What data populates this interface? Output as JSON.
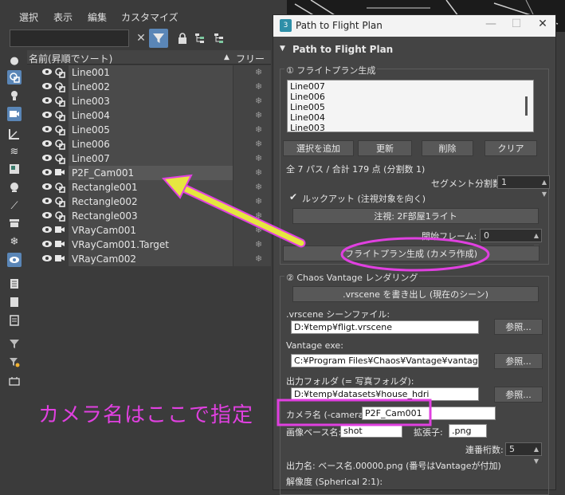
{
  "menu": [
    "選択",
    "表示",
    "編集",
    "カスタマイズ"
  ],
  "explorer": {
    "header_name": "名前(昇順でソート)",
    "header_sort": "▲",
    "header_freeze": "フリーズ",
    "rows": [
      {
        "name": "Line001",
        "type": "shape",
        "selected": false
      },
      {
        "name": "Line002",
        "type": "shape",
        "selected": false
      },
      {
        "name": "Line003",
        "type": "shape",
        "selected": false
      },
      {
        "name": "Line004",
        "type": "shape",
        "selected": false
      },
      {
        "name": "Line005",
        "type": "shape",
        "selected": false
      },
      {
        "name": "Line006",
        "type": "shape",
        "selected": false
      },
      {
        "name": "Line007",
        "type": "shape",
        "selected": false
      },
      {
        "name": "P2F_Cam001",
        "type": "camera",
        "selected": true
      },
      {
        "name": "Rectangle001",
        "type": "shape",
        "selected": false
      },
      {
        "name": "Rectangle002",
        "type": "shape",
        "selected": false
      },
      {
        "name": "Rectangle003",
        "type": "shape",
        "selected": false
      },
      {
        "name": "VRayCam001",
        "type": "camera",
        "selected": false
      },
      {
        "name": "VRayCam001.Target",
        "type": "camera",
        "selected": false
      },
      {
        "name": "VRayCam002",
        "type": "camera",
        "selected": false
      }
    ]
  },
  "annotation": {
    "label": "カメラ名はここで指定",
    "color": "#e040e0",
    "arrow_color": "#e6e640"
  },
  "dialog": {
    "app_icon": "3",
    "title": "Path to Flight Plan",
    "minimize": "—",
    "maximize": "☐",
    "close": "✕",
    "rollout_title": "Path to Flight Plan",
    "rollout_toggle": "▼",
    "section1": {
      "title": "① フライトプラン生成",
      "list_items": [
        "Line007",
        "Line006",
        "Line005",
        "Line004",
        "Line003"
      ],
      "buttons": [
        "選択を追加",
        "更新",
        "削除",
        "クリア"
      ],
      "summary": "全 7 パス / 合計 179 点 (分割数 1)",
      "segment_label": "セグメント分割数:",
      "segment_value": "1",
      "lookat_label": "ルックアット (注視対象を向く)",
      "lookat_checked": true,
      "target_button": "注視: 2F部屋1ライト",
      "start_frame_label": "開始フレーム:",
      "start_frame_value": "0",
      "generate_button": "フライトプラン生成 (カメラ作成)"
    },
    "section2": {
      "title": "② Chaos Vantage レンダリング",
      "export_button": ".vrscene を書き出し (現在のシーン)",
      "vrscene_label": ".vrscene シーンファイル:",
      "vrscene_value": "D:¥temp¥fligt.vrscene",
      "browse": "参照...",
      "vantage_label": "Vantage exe:",
      "vantage_value": "C:¥Program Files¥Chaos¥Vantage¥vantage.exe",
      "output_label": "出力フォルダ (= 写真フォルダ):",
      "output_value": "D:¥temp¥datasets¥house_hdri",
      "camera_label": "カメラ名 (-camera):",
      "camera_value": "P2F_Cam001",
      "basename_label": "画像ベース名:",
      "basename_value": "shot",
      "ext_label": "拡張子:",
      "ext_value": ".png",
      "digits_label": "連番桁数:",
      "digits_value": "5",
      "output_name_label": "出力名: ベース名.00000.png (番号はVantageが付加)",
      "resolution_label": "解像度 (Spherical 2:1):"
    }
  }
}
